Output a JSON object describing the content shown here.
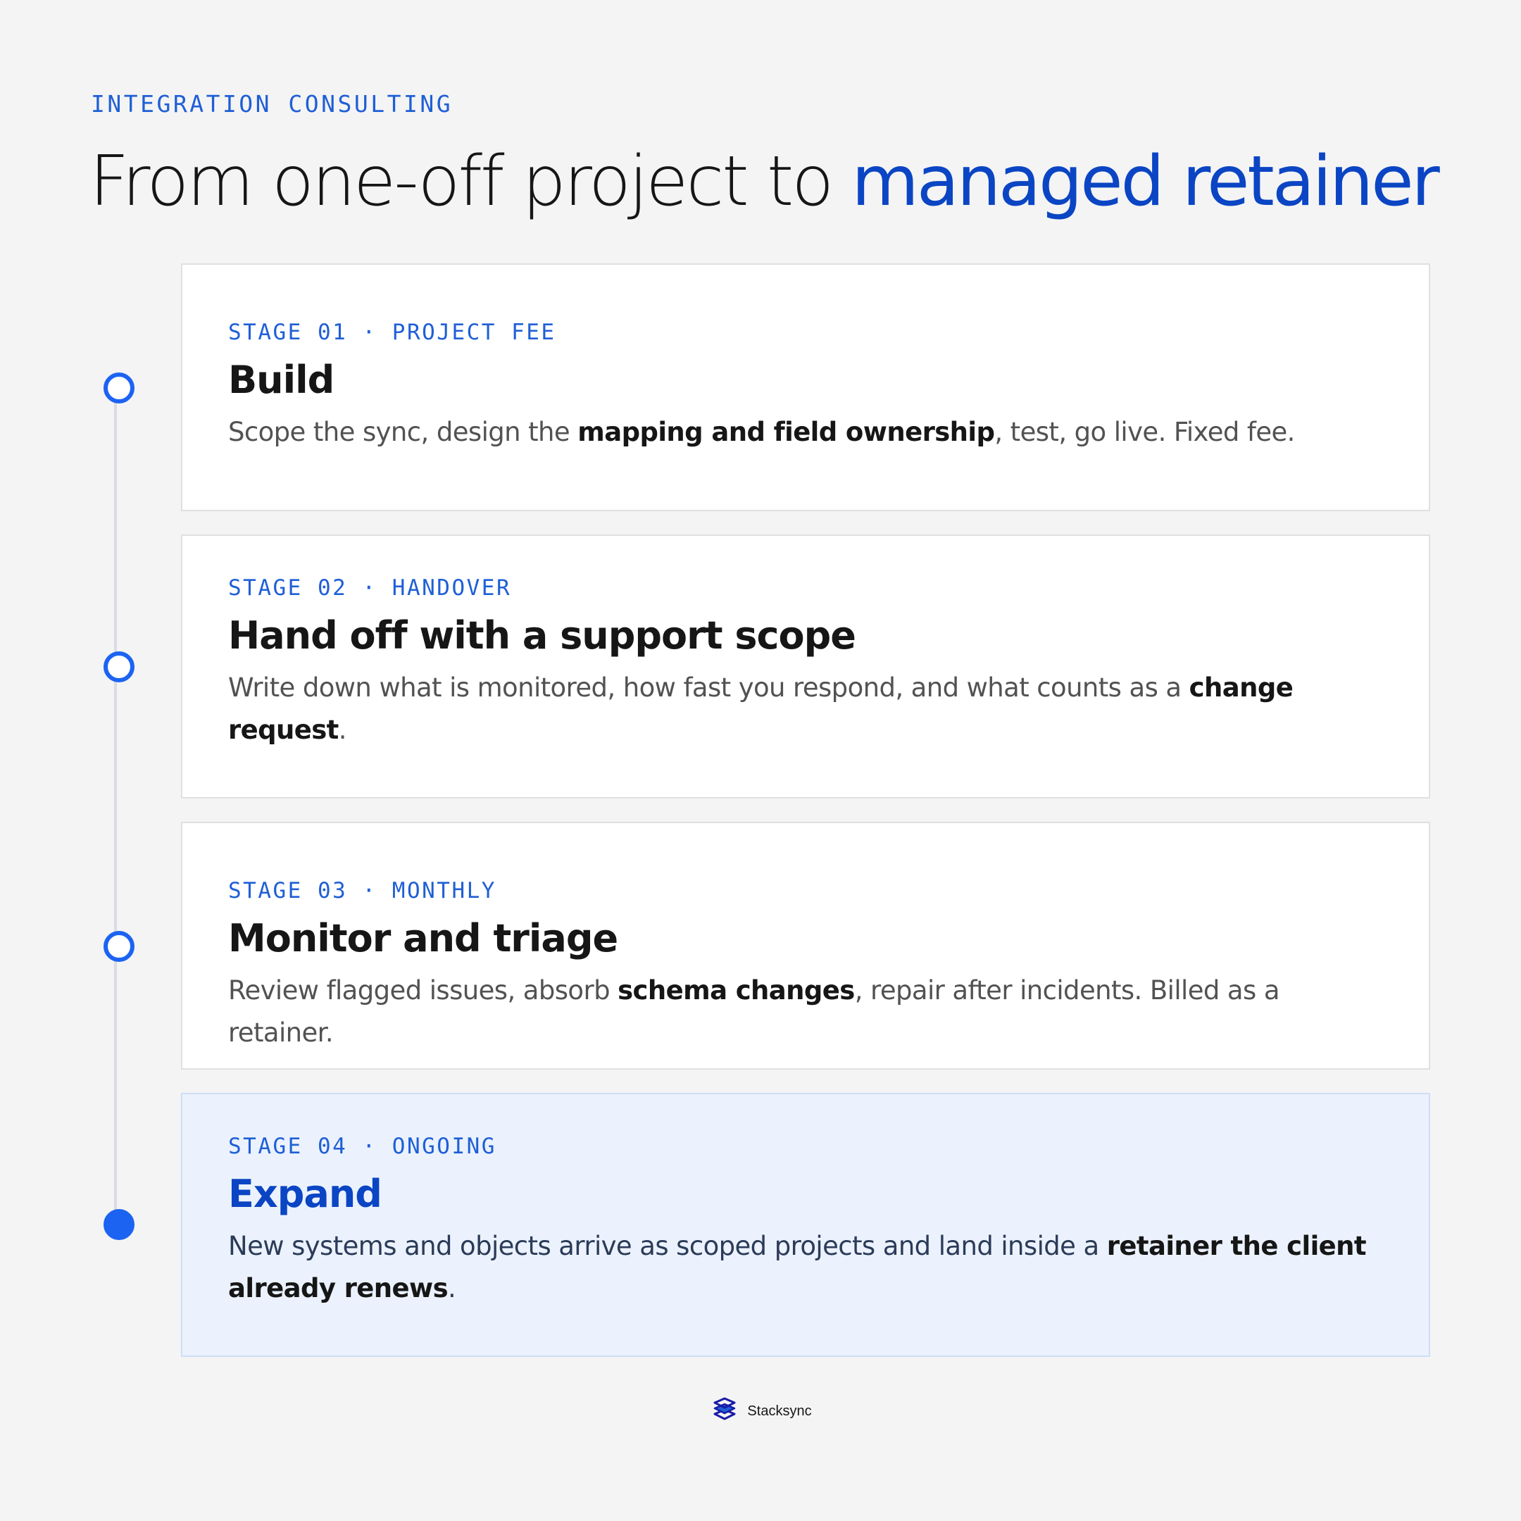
{
  "header": {
    "eyebrow": "INTEGRATION CONSULTING",
    "title_main": "From one-off project to ",
    "title_accent": "managed retainer"
  },
  "stages": [
    {
      "tag": "STAGE 01 · PROJECT FEE",
      "title": "Build",
      "desc_parts": [
        {
          "text": "Scope the sync, design the ",
          "bold": false
        },
        {
          "text": "mapping and field ownership",
          "bold": true
        },
        {
          "text": ", test, go live. Fixed fee.",
          "bold": false
        }
      ],
      "marker": "hollow"
    },
    {
      "tag": "STAGE 02 · HANDOVER",
      "title": "Hand off with a support scope",
      "desc_parts": [
        {
          "text": "Write down what is monitored, how fast you respond, and what counts as a ",
          "bold": false
        },
        {
          "text": "change request",
          "bold": true
        },
        {
          "text": ".",
          "bold": false
        }
      ],
      "marker": "hollow"
    },
    {
      "tag": "STAGE 03 · MONTHLY",
      "title": "Monitor and triage",
      "desc_parts": [
        {
          "text": "Review flagged issues, absorb ",
          "bold": false
        },
        {
          "text": "schema changes",
          "bold": true
        },
        {
          "text": ", repair after incidents. Billed as a retainer.",
          "bold": false
        }
      ],
      "marker": "hollow"
    },
    {
      "tag": "STAGE 04 · ONGOING",
      "title": "Expand",
      "desc_parts": [
        {
          "text": "New systems and objects arrive as scoped projects and land inside a ",
          "bold": false
        },
        {
          "text": "retainer the client already renews",
          "bold": true
        },
        {
          "text": ".",
          "bold": false
        }
      ],
      "marker": "filled",
      "highlighted": true
    }
  ],
  "footer": {
    "brand": "Stacksync",
    "logo_icon": "stacksync-logo-icon"
  },
  "colors": {
    "accent": "#0b45c4",
    "accent_light": "#1f5fd6",
    "marker": "#1c63f2",
    "background": "#f4f4f4",
    "card": "#ffffff",
    "highlight_card": "#ebf2fd"
  }
}
